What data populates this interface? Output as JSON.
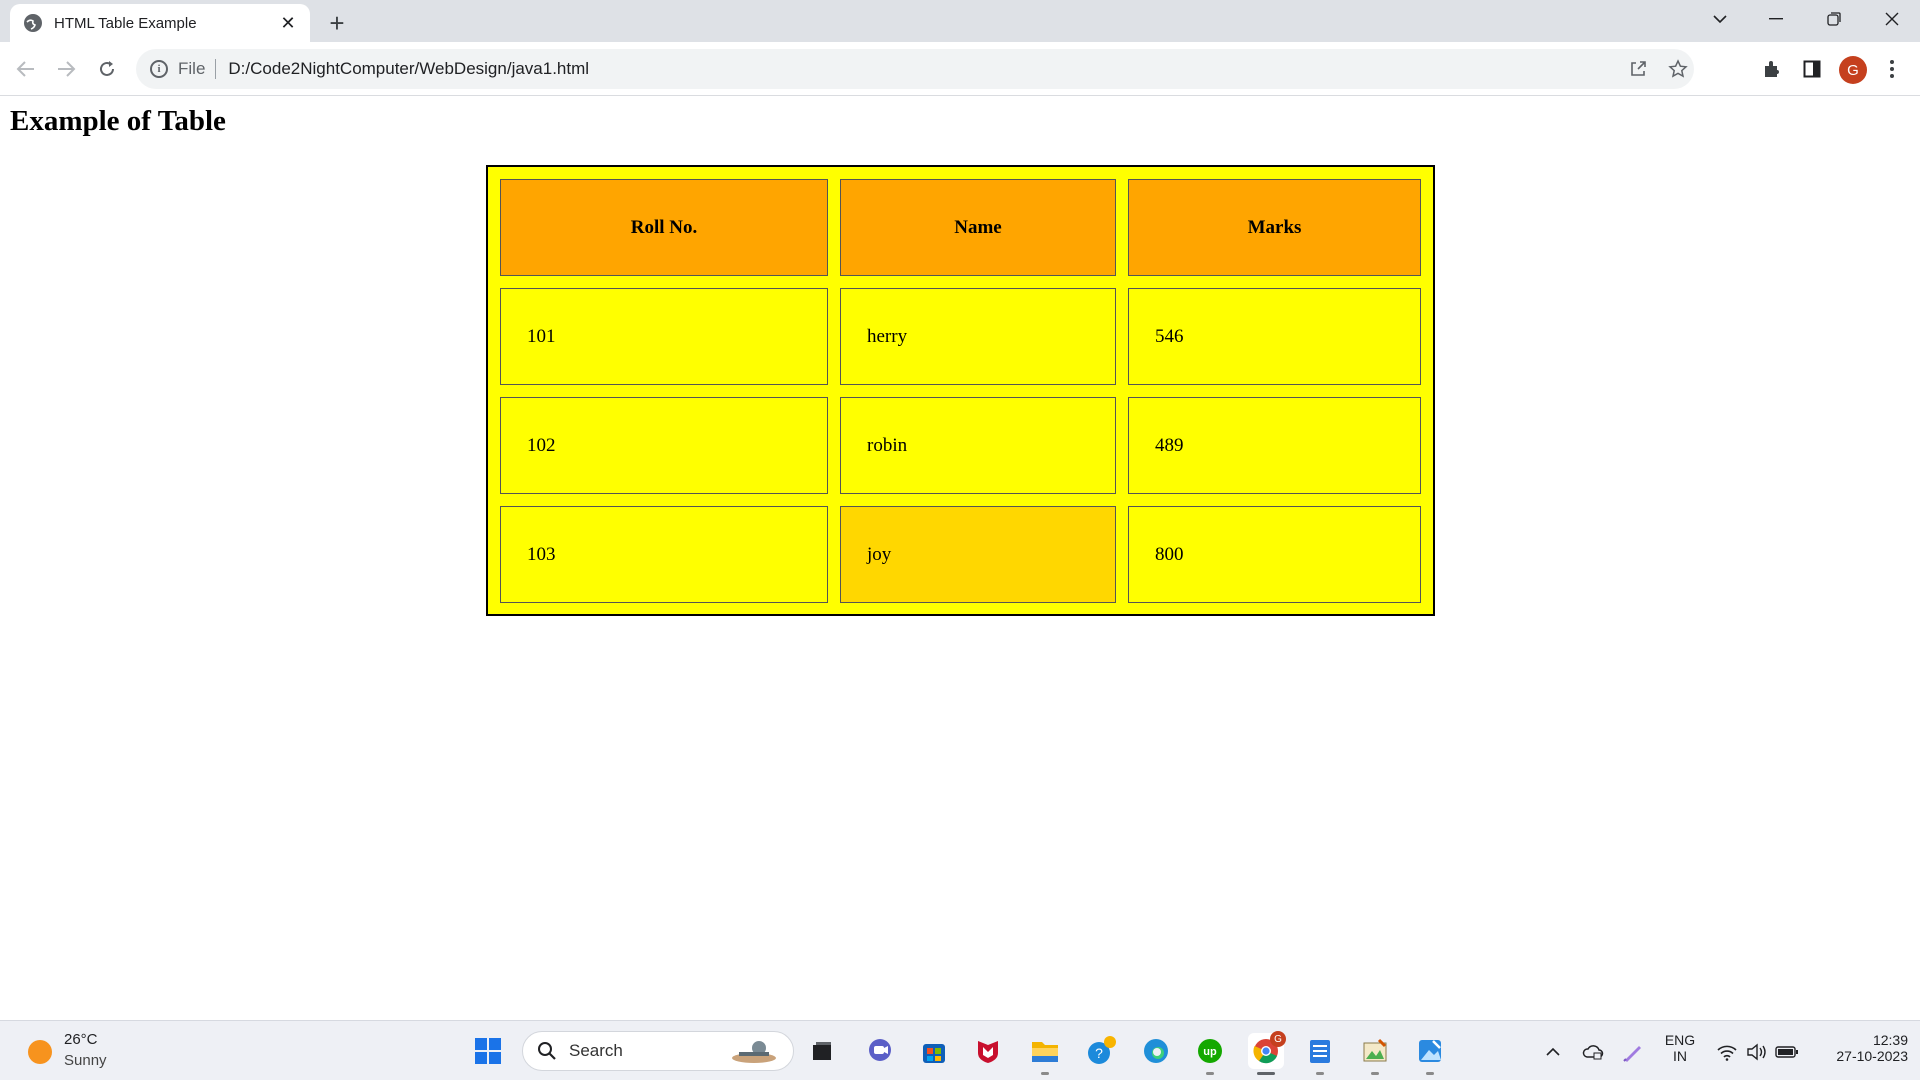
{
  "browser": {
    "tab_title": "HTML Table Example",
    "new_tab_label": "+",
    "scheme_label": "File",
    "url": "D:/Code2NightComputer/WebDesign/java1.html",
    "profile_initial": "G"
  },
  "page": {
    "heading": "Example of Table",
    "table": {
      "headers": [
        "Roll No.",
        "Name",
        "Marks"
      ],
      "rows": [
        [
          "101",
          "herry",
          "546"
        ],
        [
          "102",
          "robin",
          "489"
        ],
        [
          "103",
          "joy",
          "800"
        ]
      ],
      "colors": {
        "table_bg": "#ffff00",
        "header_bg": "#ffa500",
        "highlight_cell_bg": "#ffd700"
      }
    }
  },
  "taskbar": {
    "weather_temp": "26°C",
    "weather_condition": "Sunny",
    "search_label": "Search",
    "language_top": "ENG",
    "language_bottom": "IN",
    "time": "12:39",
    "date": "27-10-2023",
    "chrome_badge": "G"
  },
  "colors": {
    "tabstrip_bg": "#dee1e6",
    "omnibox_bg": "#f1f3f4",
    "avatar_bg": "#c5401e",
    "taskbar_bg": "#eef0f5"
  }
}
